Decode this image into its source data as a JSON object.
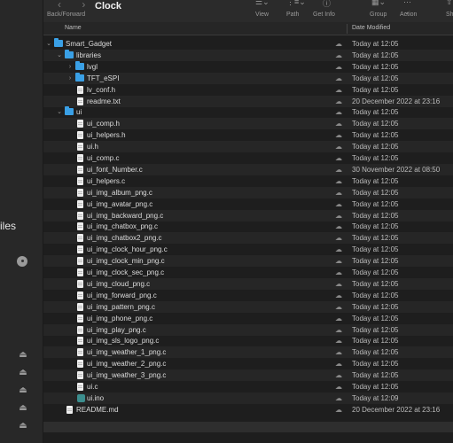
{
  "sidebar": {
    "partial_label": "iles",
    "icons": [
      "disk-icon",
      "eject-icon",
      "eject-icon",
      "eject-icon",
      "eject-icon",
      "eject-icon"
    ]
  },
  "toolbar": {
    "nav_label": "Back/Forward",
    "title": "Clock",
    "items": [
      {
        "label": "View",
        "icon": "list-view-icon"
      },
      {
        "label": "Path",
        "icon": "path-icon"
      },
      {
        "label": "Get Info",
        "icon": "info-icon"
      },
      {
        "label": "Group",
        "icon": "group-icon"
      },
      {
        "label": "Action",
        "icon": "action-icon"
      },
      {
        "label": "Sh",
        "icon": "share-icon"
      }
    ]
  },
  "columns": {
    "name": "Name",
    "date": "Date Modified"
  },
  "files": [
    {
      "name": "Smart_Gadget",
      "type": "folder",
      "level": 0,
      "expanded": true,
      "date": "Today at 12:05"
    },
    {
      "name": "libraries",
      "type": "folder",
      "level": 1,
      "expanded": true,
      "date": "Today at 12:05"
    },
    {
      "name": "lvgl",
      "type": "folder",
      "level": 2,
      "expanded": false,
      "date": "Today at 12:05"
    },
    {
      "name": "TFT_eSPI",
      "type": "folder",
      "level": 2,
      "expanded": false,
      "date": "Today at 12:05"
    },
    {
      "name": "lv_conf.h",
      "type": "file",
      "level": 2,
      "date": "Today at 12:05"
    },
    {
      "name": "readme.txt",
      "type": "file",
      "level": 2,
      "date": "20 December 2022 at 23:16"
    },
    {
      "name": "ui",
      "type": "folder",
      "level": 1,
      "expanded": true,
      "date": "Today at 12:05"
    },
    {
      "name": "ui_comp.h",
      "type": "file",
      "level": 2,
      "date": "Today at 12:05"
    },
    {
      "name": "ui_helpers.h",
      "type": "file",
      "level": 2,
      "date": "Today at 12:05"
    },
    {
      "name": "ui.h",
      "type": "file",
      "level": 2,
      "date": "Today at 12:05"
    },
    {
      "name": "ui_comp.c",
      "type": "file",
      "level": 2,
      "date": "Today at 12:05"
    },
    {
      "name": "ui_font_Number.c",
      "type": "file",
      "level": 2,
      "date": "30 November 2022 at 08:50"
    },
    {
      "name": "ui_helpers.c",
      "type": "file",
      "level": 2,
      "date": "Today at 12:05"
    },
    {
      "name": "ui_img_album_png.c",
      "type": "file",
      "level": 2,
      "date": "Today at 12:05"
    },
    {
      "name": "ui_img_avatar_png.c",
      "type": "file",
      "level": 2,
      "date": "Today at 12:05"
    },
    {
      "name": "ui_img_backward_png.c",
      "type": "file",
      "level": 2,
      "date": "Today at 12:05"
    },
    {
      "name": "ui_img_chatbox_png.c",
      "type": "file",
      "level": 2,
      "date": "Today at 12:05"
    },
    {
      "name": "ui_img_chatbox2_png.c",
      "type": "file",
      "level": 2,
      "date": "Today at 12:05"
    },
    {
      "name": "ui_img_clock_hour_png.c",
      "type": "file",
      "level": 2,
      "date": "Today at 12:05"
    },
    {
      "name": "ui_img_clock_min_png.c",
      "type": "file",
      "level": 2,
      "date": "Today at 12:05"
    },
    {
      "name": "ui_img_clock_sec_png.c",
      "type": "file",
      "level": 2,
      "date": "Today at 12:05"
    },
    {
      "name": "ui_img_cloud_png.c",
      "type": "file",
      "level": 2,
      "date": "Today at 12:05"
    },
    {
      "name": "ui_img_forward_png.c",
      "type": "file",
      "level": 2,
      "date": "Today at 12:05"
    },
    {
      "name": "ui_img_pattern_png.c",
      "type": "file",
      "level": 2,
      "date": "Today at 12:05"
    },
    {
      "name": "ui_img_phone_png.c",
      "type": "file",
      "level": 2,
      "date": "Today at 12:05"
    },
    {
      "name": "ui_img_play_png.c",
      "type": "file",
      "level": 2,
      "date": "Today at 12:05"
    },
    {
      "name": "ui_img_sls_logo_png.c",
      "type": "file",
      "level": 2,
      "date": "Today at 12:05"
    },
    {
      "name": "ui_img_weather_1_png.c",
      "type": "file",
      "level": 2,
      "date": "Today at 12:05"
    },
    {
      "name": "ui_img_weather_2_png.c",
      "type": "file",
      "level": 2,
      "date": "Today at 12:05"
    },
    {
      "name": "ui_img_weather_3_png.c",
      "type": "file",
      "level": 2,
      "date": "Today at 12:05"
    },
    {
      "name": "ui.c",
      "type": "file",
      "level": 2,
      "date": "Today at 12:05"
    },
    {
      "name": "ui.ino",
      "type": "ino",
      "level": 2,
      "date": "Today at 12:09"
    },
    {
      "name": "README.md",
      "type": "file",
      "level": 1,
      "date": "20 December 2022 at 23:16"
    }
  ]
}
